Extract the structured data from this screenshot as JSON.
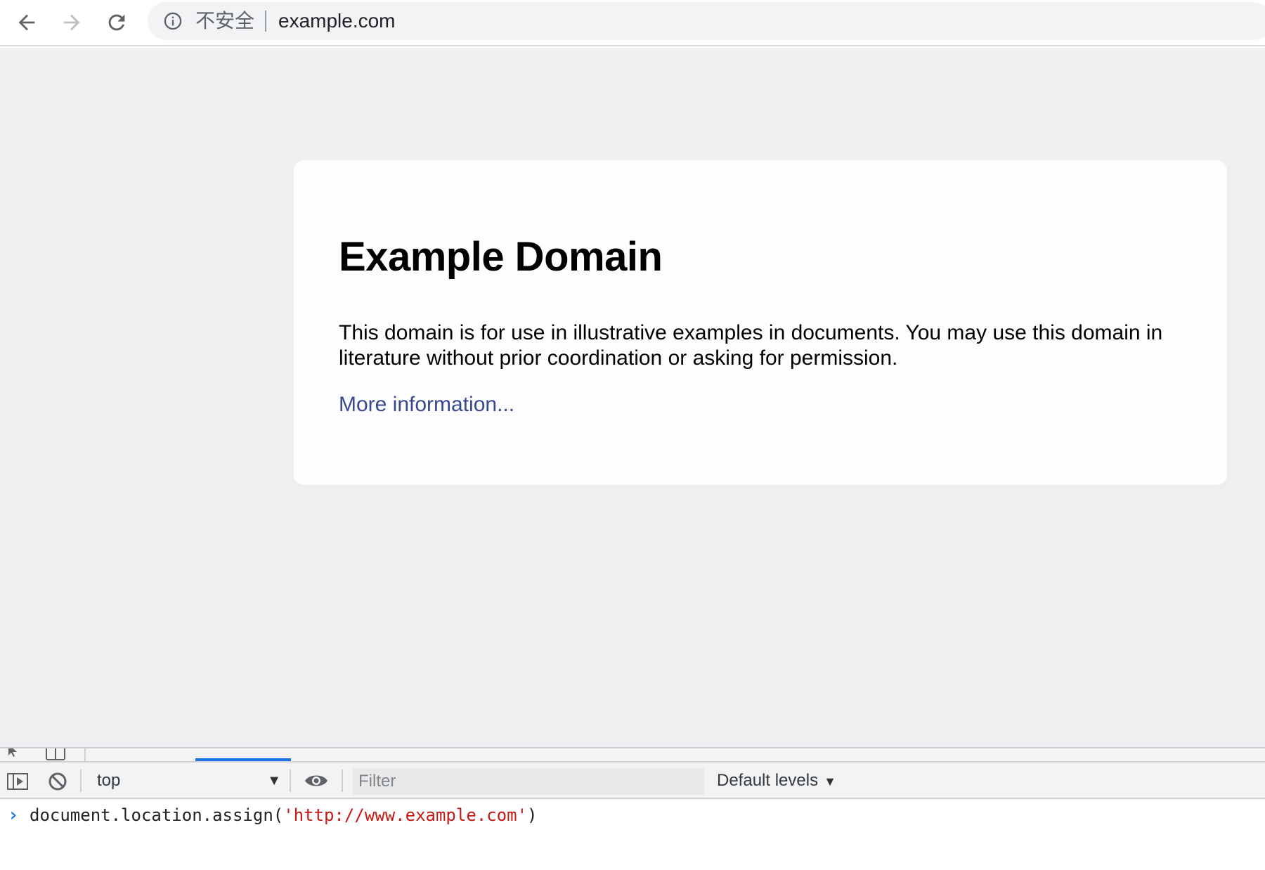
{
  "browser": {
    "security_label": "不安全",
    "url": "example.com"
  },
  "page": {
    "title": "Example Domain",
    "paragraph": "This domain is for use in illustrative examples in documents. You may use this domain in literature without prior coordination or asking for permission.",
    "link_text": "More information..."
  },
  "devtools": {
    "context": "top",
    "filter_placeholder": "Filter",
    "levels": "Default levels",
    "console_input": {
      "code_before": "document.location.assign(",
      "string_arg": "'http://www.example.com'",
      "code_after": ")"
    }
  },
  "colors": {
    "page_background": "#f0f0f2",
    "card_background": "#fdfdff",
    "link": "#38488f",
    "console_string": "#c41a16",
    "active_tab": "#1a73e8"
  }
}
